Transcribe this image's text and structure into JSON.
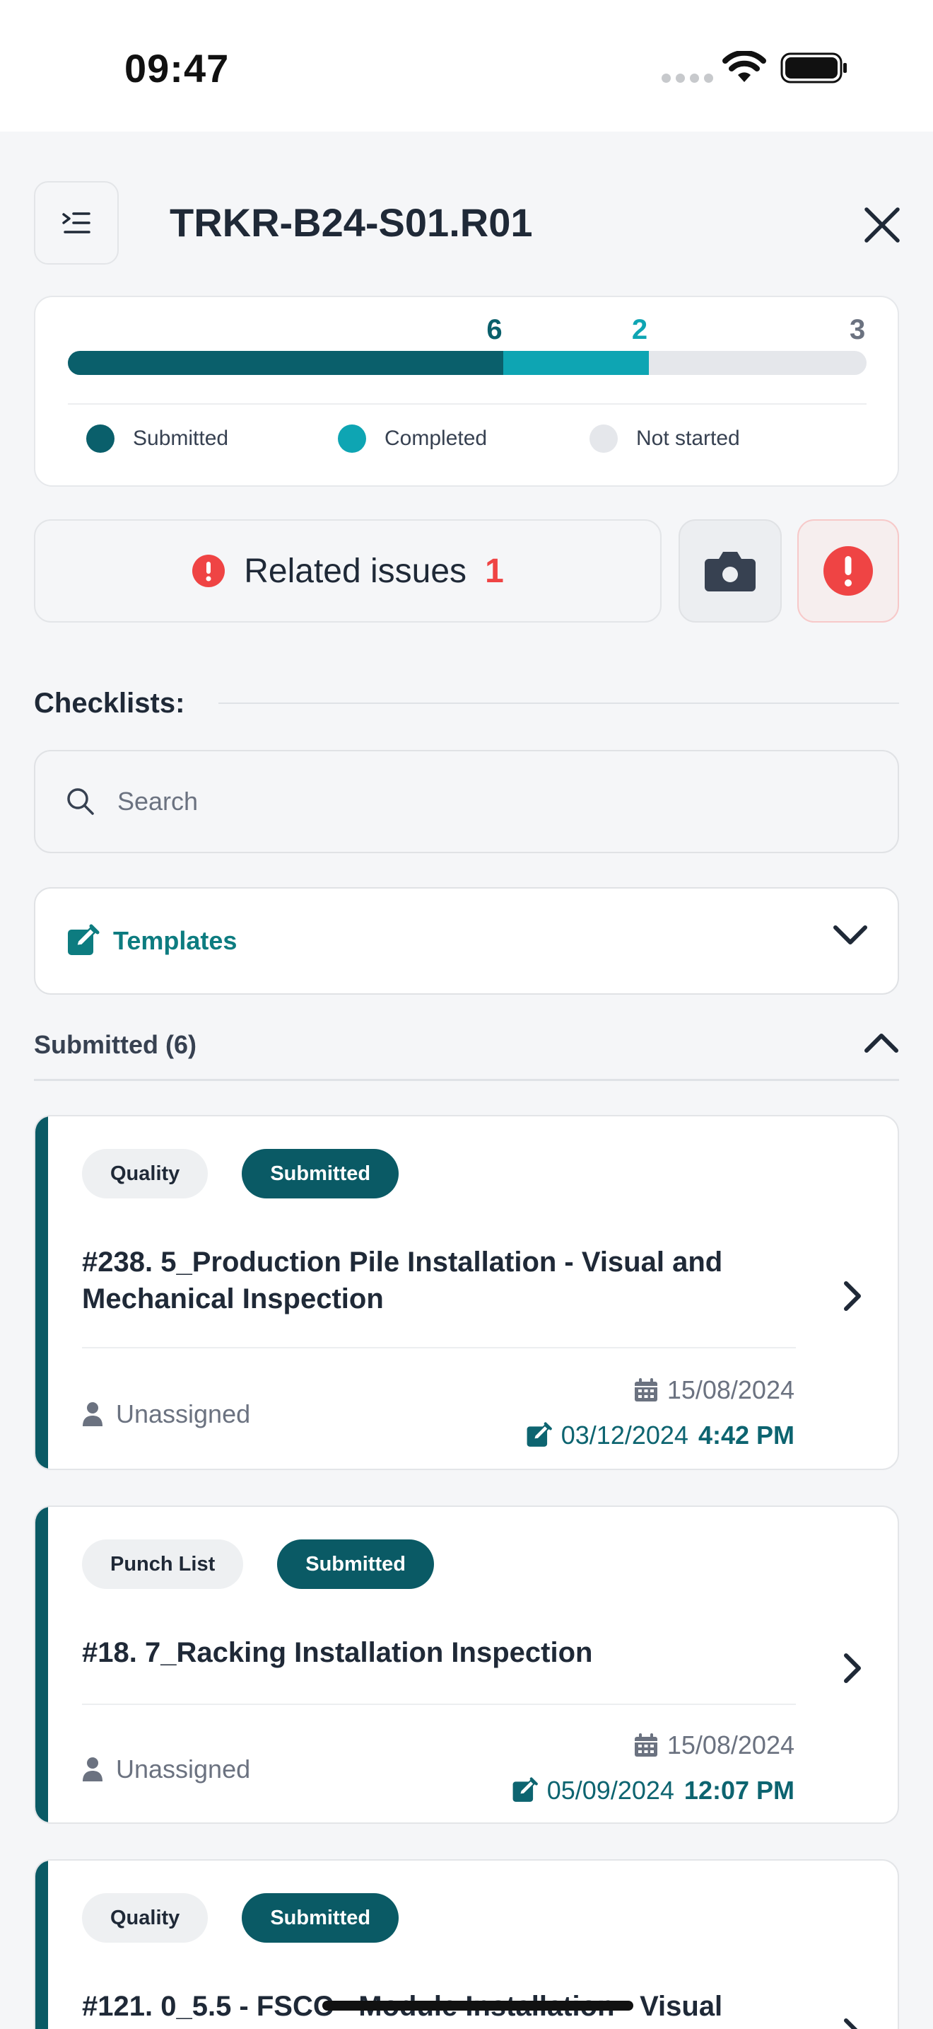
{
  "status_bar": {
    "time": "09:47"
  },
  "header": {
    "title": "TRKR-B24-S01.R01"
  },
  "progress": {
    "submitted": {
      "count": 6,
      "label": "Submitted",
      "color": "#0a5f6b"
    },
    "completed": {
      "count": 2,
      "label": "Completed",
      "color": "#0ea5b3"
    },
    "not_started": {
      "count": 3,
      "label": "Not started",
      "color": "#e5e7eb"
    }
  },
  "actions": {
    "related_label": "Related issues",
    "related_count": "1",
    "camera_icon": "camera-icon",
    "alert_icon": "alert-circle-icon"
  },
  "checklists": {
    "heading": "Checklists:",
    "search_placeholder": "Search",
    "templates_label": "Templates"
  },
  "group": {
    "label": "Submitted (6)"
  },
  "cards": [
    {
      "type": "Quality",
      "status": "Submitted",
      "title": "#238. 5_Production Pile Installation - Visual and Mechanical Inspection",
      "assignee": "Unassigned",
      "date": "15/08/2024",
      "edited_date": "03/12/2024",
      "edited_time": "4:42 PM"
    },
    {
      "type": "Punch List",
      "status": "Submitted",
      "title": "#18. 7_Racking Installation Inspection",
      "assignee": "Unassigned",
      "date": "15/08/2024",
      "edited_date": "05/09/2024",
      "edited_time": "12:07 PM"
    },
    {
      "type": "Quality",
      "status": "Submitted",
      "title": "#121. 0_5.5 - FSCC - Module Installation - Visual"
    }
  ]
}
